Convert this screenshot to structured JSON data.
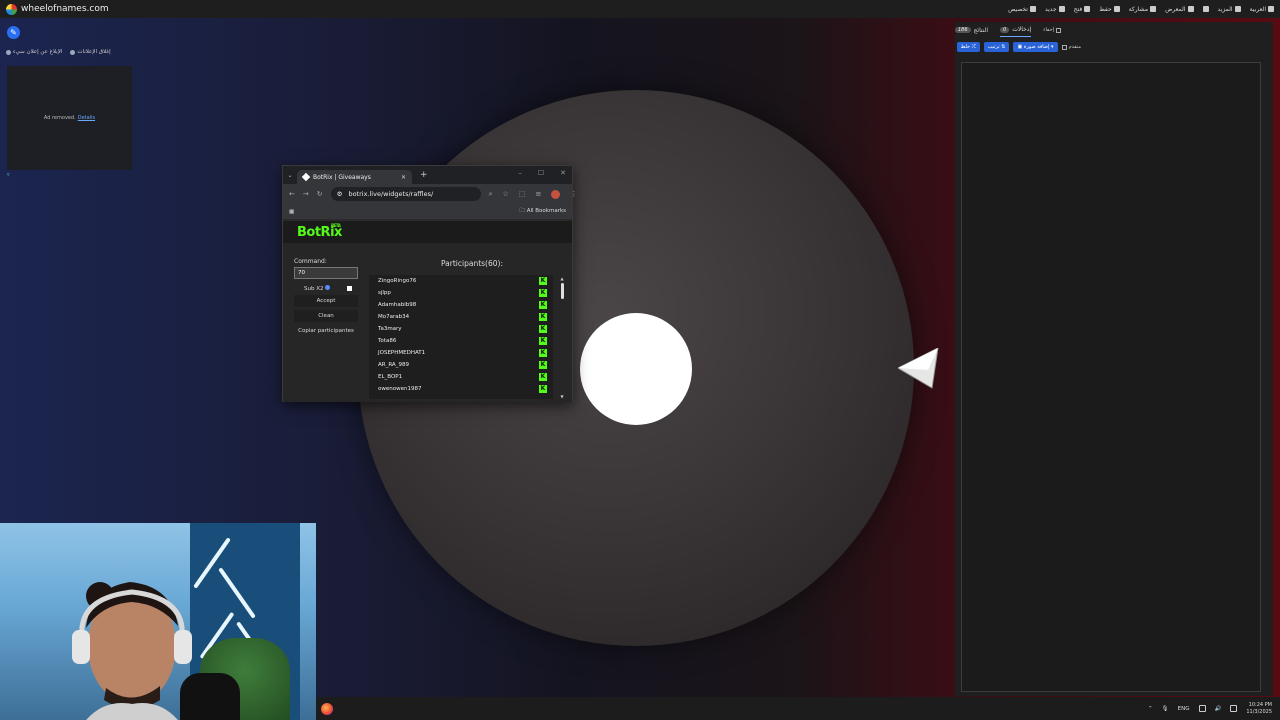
{
  "site": {
    "domain": "wheelofnames.com",
    "top_menu": [
      "العربية",
      "المزيد",
      "",
      "المعرض",
      "مشاركة",
      "حفظ",
      "فتح",
      "جديد",
      "تخصيص"
    ]
  },
  "left": {
    "report_label": "الإبلاغ عن إعلان سيء",
    "close_ads_label": "إغلاق الإعلانات",
    "ad_text": "Ad removed.",
    "ad_link": "Details"
  },
  "right_panel": {
    "tabs": [
      {
        "label": "إدخالات",
        "badge": "0",
        "active": true
      },
      {
        "label": "النتائج",
        "badge": "186",
        "active": false
      }
    ],
    "hide_label": "إخفاء",
    "tools": {
      "shuffle": "خلط",
      "sort": "ترتيب",
      "add_image": "إضافة صورة",
      "advanced": "متقدم"
    }
  },
  "browser": {
    "tab_title": "BotRix | Giveaways",
    "url": "botrix.live/widgets/raffles/",
    "bookmarks": "All Bookmarks",
    "profile_initial": "I"
  },
  "botrix": {
    "logo": "BotRix",
    "beta": "BETA",
    "command_label": "Command:",
    "command_value": "70",
    "sub_label": "Sub X2",
    "accept": "Accept",
    "clean": "Clean",
    "copy": "Copiar participantes",
    "participants_title": "Participants(60):",
    "participants": [
      "ZingoRingo76",
      "sjlpp",
      "Adamhabib98",
      "Mo7arab34",
      "Ta3mary",
      "Tota86",
      "JOSEPHMEDHAT1",
      "AR_RA_989",
      "EL_BOP1",
      "owenowen1987"
    ],
    "kick_glyph": "K"
  },
  "taskbar": {
    "lang": "ENG",
    "time": "10:24 PM",
    "date": "11/3/2025"
  }
}
